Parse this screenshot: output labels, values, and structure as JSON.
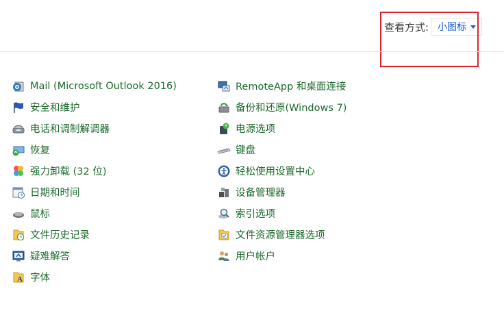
{
  "view": {
    "label": "查看方式:",
    "selected": "小图标"
  },
  "left_items": [
    {
      "label": "Mail (Microsoft Outlook 2016)",
      "icon": "mail-icon"
    },
    {
      "label": "安全和维护",
      "icon": "flag-icon"
    },
    {
      "label": "电话和调制解调器",
      "icon": "phone-modem-icon"
    },
    {
      "label": "恢复",
      "icon": "recovery-icon"
    },
    {
      "label": "强力卸载 (32 位)",
      "icon": "uninstall-icon"
    },
    {
      "label": "日期和时间",
      "icon": "calendar-clock-icon"
    },
    {
      "label": "鼠标",
      "icon": "mouse-icon"
    },
    {
      "label": "文件历史记录",
      "icon": "file-history-icon"
    },
    {
      "label": "疑难解答",
      "icon": "troubleshoot-icon"
    },
    {
      "label": "字体",
      "icon": "font-icon"
    }
  ],
  "right_items": [
    {
      "label": "RemoteApp 和桌面连接",
      "icon": "remoteapp-icon"
    },
    {
      "label": "备份和还原(Windows 7)",
      "icon": "backup-restore-icon"
    },
    {
      "label": "电源选项",
      "icon": "power-options-icon"
    },
    {
      "label": "键盘",
      "icon": "keyboard-icon"
    },
    {
      "label": "轻松使用设置中心",
      "icon": "ease-of-access-icon"
    },
    {
      "label": "设备管理器",
      "icon": "device-manager-icon"
    },
    {
      "label": "索引选项",
      "icon": "indexing-icon"
    },
    {
      "label": "文件资源管理器选项",
      "icon": "folder-options-icon"
    },
    {
      "label": "用户帐户",
      "icon": "user-accounts-icon"
    }
  ]
}
